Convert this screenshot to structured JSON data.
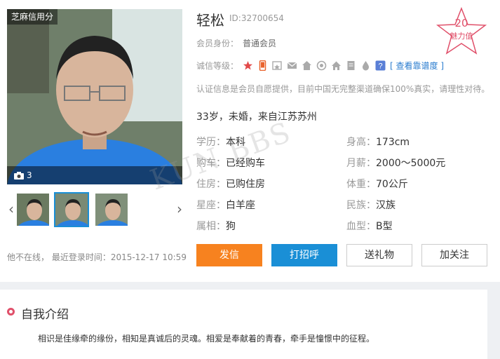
{
  "photo": {
    "badge": "芝麻信用分",
    "count": "3"
  },
  "profile": {
    "name": "轻松",
    "id_text": "ID:32700654",
    "member_label": "会员身份：",
    "member_value": "普通会员",
    "integrity_label": "诚信等级：",
    "integrity_link": "[ 查看靠谱度 ]",
    "notice": "认证信息是会员自愿提供，目前中国无完整渠道确保100%真实，请理性对待。",
    "charm_value": "20",
    "charm_label": "魅力值",
    "summary": "33岁，未婚，来自江苏苏州"
  },
  "details": {
    "education_k": "学历：",
    "education_v": "本科",
    "height_k": "身高：",
    "height_v": "173cm",
    "car_k": "购车：",
    "car_v": "已经购车",
    "salary_k": "月薪：",
    "salary_v": "2000～5000元",
    "house_k": "住房：",
    "house_v": "已购住房",
    "weight_k": "体重：",
    "weight_v": "70公斤",
    "star_k": "星座：",
    "star_v": "白羊座",
    "nation_k": "民族：",
    "nation_v": "汉族",
    "zodiac_k": "属相：",
    "zodiac_v": "狗",
    "blood_k": "血型：",
    "blood_v": "B型"
  },
  "online_text": "他不在线，  最近登录时间：2015-12-17 10:59",
  "buttons": {
    "send": "发信",
    "greet": "打招呼",
    "gift": "送礼物",
    "follow": "加关注"
  },
  "intro": {
    "title": "自我介绍",
    "text": "相识是佳缘牵的缘份，相知是真诚后的灵魂。相爱是奉献着的青春，牵手是憧憬中的征程。"
  },
  "watermark": "KUN  BBS",
  "colors": {
    "accent_orange": "#f7821f",
    "accent_blue": "#1a8fd6",
    "charm_pink": "#e0506a"
  }
}
